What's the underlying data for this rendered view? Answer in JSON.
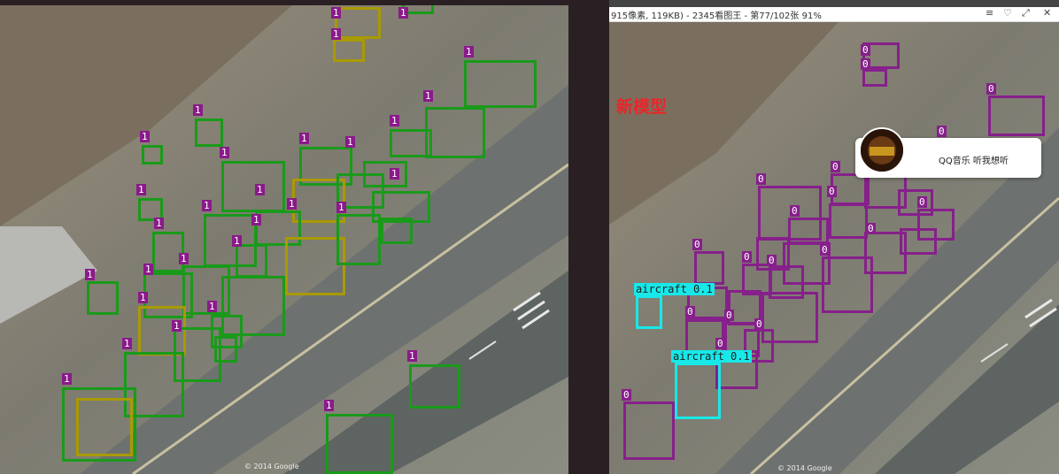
{
  "window": {
    "title": "915像素, 119KB) - 2345看图王 - 第77/102张 91%",
    "controls": [
      "≡",
      "♡",
      "⤢",
      "✕"
    ]
  },
  "left_view": {
    "label_text": "1",
    "watermark": "© 2014 Google",
    "colors": {
      "box_green": "#1a9a1a",
      "box_olive": "#a89a00",
      "tag_bg": "#8a1a8a"
    }
  },
  "right_view": {
    "label_text": "0",
    "caption": "新模型",
    "detection_class": "aircraft 0.1",
    "watermark": "© 2014 Google",
    "colors": {
      "box_purple": "#86208a",
      "box_cyan": "#18e8e8",
      "caption_red": "#e8262a"
    }
  },
  "popup": {
    "text": "QQ音乐 听我想听"
  }
}
